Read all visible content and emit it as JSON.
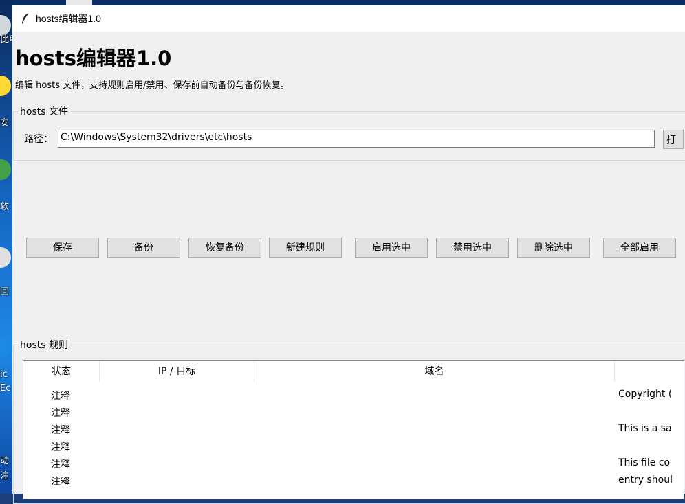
{
  "window": {
    "title": "hosts编辑器1.0"
  },
  "header": {
    "title": "hosts编辑器1.0",
    "subtitle": "编辑 hosts 文件，支持规则启用/禁用、保存前自动备份与备份恢复。"
  },
  "file_group": {
    "legend": "hosts 文件",
    "path_label": "路径：",
    "path_value": "C:\\Windows\\System32\\drivers\\etc\\hosts",
    "browse_label": "打"
  },
  "toolbar": {
    "save": "保存",
    "backup": "备份",
    "restore": "恢复备份",
    "new_rule": "新建规则",
    "enable_selected": "启用选中",
    "disable_selected": "禁用选中",
    "delete_selected": "删除选中",
    "enable_all": "全部启用"
  },
  "rules_group": {
    "legend": "hosts 规则",
    "columns": [
      "状态",
      "IP / 目标",
      "域名",
      ""
    ],
    "rows": [
      {
        "status": "注释",
        "comment": "Copyright ("
      },
      {
        "status": "注释",
        "comment": ""
      },
      {
        "status": "注释",
        "comment": "This is a sa"
      },
      {
        "status": "注释",
        "comment": ""
      },
      {
        "status": "注释",
        "comment": "This file co"
      },
      {
        "status": "注释",
        "comment": "entry shoul"
      }
    ]
  },
  "desktop": {
    "labels": [
      "此电",
      "安",
      "软",
      "回",
      "ic",
      "Ec",
      "动",
      "注"
    ]
  }
}
